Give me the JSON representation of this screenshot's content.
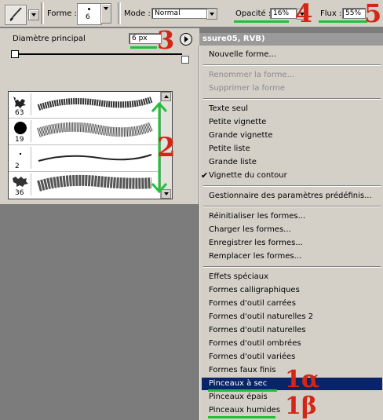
{
  "toolbar": {
    "forme_label": "Forme :",
    "forme_value": "6",
    "mode_label": "Mode :",
    "mode_value": "Normal",
    "opacite_label": "Opacité :",
    "opacite_value": "16%",
    "flux_label": "Flux :",
    "flux_value": "55%"
  },
  "palette": {
    "diameter_label": "Diamètre principal",
    "diameter_value": "6 px",
    "brushes": [
      {
        "size": "63"
      },
      {
        "size": "19"
      },
      {
        "size": "2"
      },
      {
        "size": "36"
      }
    ]
  },
  "menu": {
    "title": "ssure05, RVB)",
    "items": [
      "Nouvelle forme...",
      "Renommer la forme...",
      "Supprimer la forme",
      "Texte seul",
      "Petite vignette",
      "Grande vignette",
      "Petite liste",
      "Grande liste",
      "Vignette du contour",
      "Gestionnaire des paramètres prédéfinis...",
      "Réinitialiser les formes...",
      "Charger les formes...",
      "Enregistrer les formes...",
      "Remplacer les formes...",
      "Effets spéciaux",
      "Formes calligraphiques",
      "Formes d'outil carrées",
      "Formes d'outil naturelles 2",
      "Formes d'outil naturelles",
      "Formes d'outil ombrées",
      "Formes d'outil variées",
      "Formes faux finis",
      "Pinceaux à sec",
      "Pinceaux épais",
      "Pinceaux humides"
    ]
  },
  "annotations": {
    "n1a": "1α",
    "n1b": "1β",
    "n2": "2",
    "n3": "3",
    "n4": "4",
    "n5": "5"
  },
  "colors": {
    "annotation_green": "#22c03a",
    "annotation_red": "#d42616",
    "highlight": "#0a246a"
  }
}
